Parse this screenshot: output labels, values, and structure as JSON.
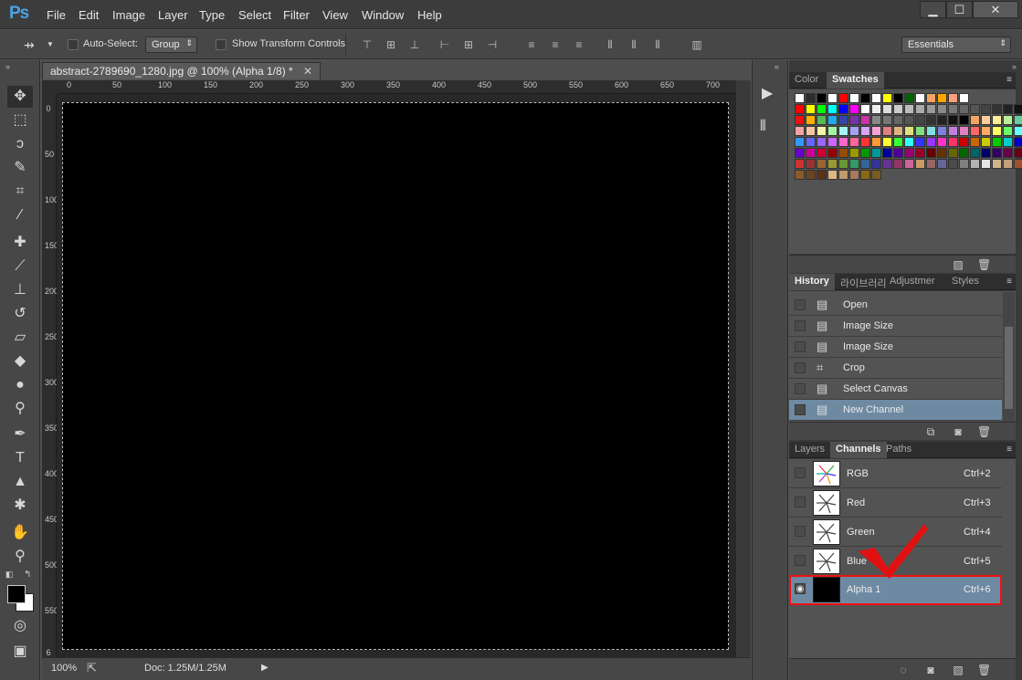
{
  "app": {
    "logo": "Ps"
  },
  "menu": [
    "File",
    "Edit",
    "Image",
    "Layer",
    "Type",
    "Select",
    "Filter",
    "View",
    "Window",
    "Help"
  ],
  "window_controls": {
    "minimize": "▁",
    "maximize": "☐",
    "close": "✕"
  },
  "options": {
    "auto_select_label": "Auto-Select:",
    "group_value": "Group",
    "transform_label": "Show Transform Controls",
    "workspace": "Essentials"
  },
  "document": {
    "tab_title": "abstract-2789690_1280.jpg @ 100% (Alpha 1/8) *",
    "zoom": "100%",
    "doc_size": "Doc: 1.25M/1.25M"
  },
  "ruler": {
    "h_ticks": [
      "0",
      "50",
      "100",
      "150",
      "200",
      "250",
      "300",
      "350",
      "400",
      "450",
      "500",
      "550",
      "600",
      "650",
      "700"
    ],
    "v_ticks": [
      "0",
      "50",
      "100",
      "150",
      "200",
      "250",
      "300",
      "350",
      "400",
      "450",
      "500",
      "550",
      "6"
    ]
  },
  "swatch_panel": {
    "tabs": [
      "Color",
      "Swatches"
    ],
    "active_tab": "Swatches",
    "colors": [
      [
        "#ffffff",
        "#2d2d2d",
        "#000000",
        "#ffffff",
        "#ff0000",
        "#ffffff",
        "#000000",
        "#ffffff",
        "#ffff00",
        "#000000",
        "#006400",
        "#ffffff",
        "#f4a460",
        "#ffa500",
        "#ffa07a",
        "#ffffff"
      ],
      [
        "#ff0000",
        "#ffff00",
        "#00ff00",
        "#00ffff",
        "#0000ff",
        "#ff00ff",
        "#ffffff",
        "#eeeeee",
        "#dddddd",
        "#cccccc",
        "#bbbbbb",
        "#aaaaaa",
        "#999999",
        "#888888",
        "#777777",
        "#666666",
        "#555555",
        "#444444",
        "#333333",
        "#222222",
        "#111111"
      ],
      [
        "#ee1111",
        "#ffb000",
        "#55bb55",
        "#22aaee",
        "#3344aa",
        "#7733aa",
        "#cc33aa",
        "#888888",
        "#777777",
        "#666666",
        "#555555",
        "#444444",
        "#333333",
        "#222222",
        "#111111",
        "#000000",
        "#f4a460",
        "#ffcc99",
        "#ffee99",
        "#bbee99",
        "#66cc99"
      ],
      [
        "#f5a3a3",
        "#f5c6a3",
        "#f5f5a3",
        "#a3f5a3",
        "#a3f5f5",
        "#a3a3f5",
        "#d7a3f5",
        "#f5a3d7",
        "#e08080",
        "#e0b080",
        "#e0e080",
        "#80e080",
        "#80e0e0",
        "#8080e0",
        "#c080e0",
        "#e080c0",
        "#ff6666",
        "#ffaa66",
        "#ffff66",
        "#66ff66",
        "#66ffff"
      ],
      [
        "#3399ff",
        "#6666ff",
        "#9966ff",
        "#cc66ff",
        "#ff66cc",
        "#ff6699",
        "#ff3333",
        "#ff9933",
        "#ffff33",
        "#33ff33",
        "#33ffff",
        "#3333ff",
        "#9933ff",
        "#ff33cc",
        "#ff3366",
        "#cc0000",
        "#cc6600",
        "#cccc00",
        "#00cc00",
        "#00cccc",
        "#0000cc"
      ],
      [
        "#6600cc",
        "#cc0099",
        "#cc0033",
        "#990000",
        "#994c00",
        "#999900",
        "#009900",
        "#009999",
        "#000099",
        "#4c0099",
        "#990073",
        "#990026",
        "#660000",
        "#663300",
        "#666600",
        "#006600",
        "#006666",
        "#000066",
        "#330066",
        "#66004c",
        "#660019"
      ],
      [
        "#cc3333",
        "#993333",
        "#996633",
        "#999933",
        "#669933",
        "#339966",
        "#336699",
        "#333399",
        "#663399",
        "#993366",
        "#cc6699",
        "#cc9966",
        "#996666",
        "#666699",
        "#4c4c4c",
        "#7f7f7f",
        "#b2b2b2",
        "#e5e5e5",
        "#d2b48c",
        "#c3a07a",
        "#a0522d"
      ],
      [
        "#8b5a2b",
        "#6b4423",
        "#5c3317",
        "#deb887",
        "#c19a6b",
        "#a67b5b",
        "#8b6914",
        "#7a5c1e"
      ]
    ]
  },
  "history_panel": {
    "tabs": [
      "History",
      "라이브러리",
      "Adjustmer",
      "Styles"
    ],
    "active_tab": "History",
    "items": [
      {
        "label": "Open",
        "icon": "document-icon"
      },
      {
        "label": "Image Size",
        "icon": "step-icon"
      },
      {
        "label": "Image Size",
        "icon": "step-icon"
      },
      {
        "label": "Crop",
        "icon": "crop-icon"
      },
      {
        "label": "Select Canvas",
        "icon": "step-icon"
      },
      {
        "label": "New Channel",
        "icon": "step-icon"
      }
    ],
    "selected_index": 5
  },
  "channels_panel": {
    "tabs": [
      "Layers",
      "Channels",
      "Paths"
    ],
    "active_tab": "Channels",
    "items": [
      {
        "label": "RGB",
        "shortcut": "Ctrl+2",
        "thumb": "flower"
      },
      {
        "label": "Red",
        "shortcut": "Ctrl+3",
        "thumb": "flower"
      },
      {
        "label": "Green",
        "shortcut": "Ctrl+4",
        "thumb": "flower"
      },
      {
        "label": "Blue",
        "shortcut": "Ctrl+5",
        "thumb": "flower"
      },
      {
        "label": "Alpha 1",
        "shortcut": "Ctrl+6",
        "thumb": "black"
      }
    ],
    "selected_index": 4
  },
  "colors": {
    "selection_blue": "#6e8aa3",
    "highlight_red": "#e11111",
    "logo_blue": "#4ba3e3"
  }
}
